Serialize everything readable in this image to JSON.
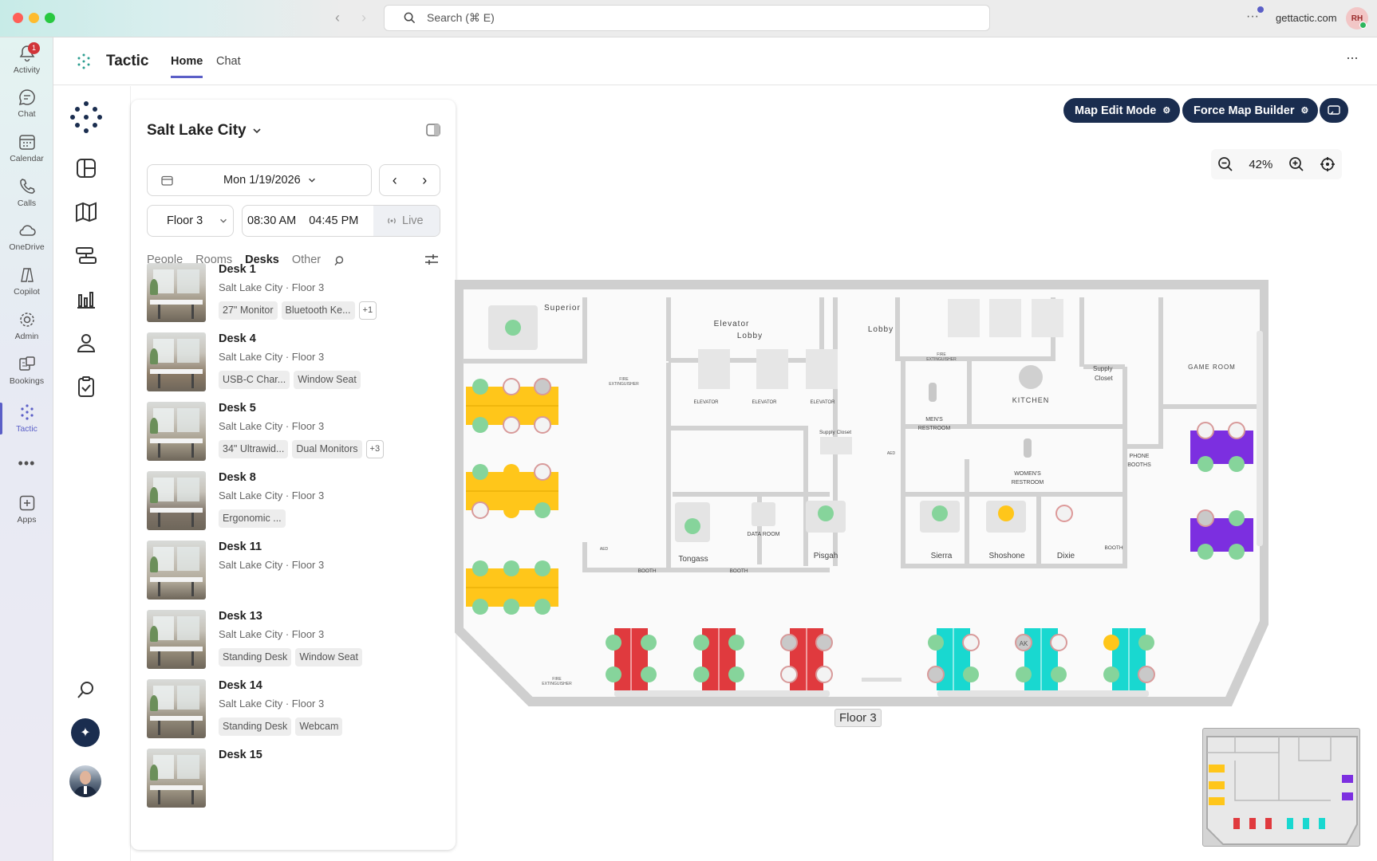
{
  "titlebar": {
    "search_placeholder": "Search (⌘ E)",
    "account_domain": "gettactic.com",
    "account_initials": "RH"
  },
  "rail": {
    "items": [
      {
        "label": "Activity",
        "icon": "bell-icon",
        "badge": "1"
      },
      {
        "label": "Chat",
        "icon": "chat-icon"
      },
      {
        "label": "Calendar",
        "icon": "calendar-icon"
      },
      {
        "label": "Calls",
        "icon": "phone-icon"
      },
      {
        "label": "OneDrive",
        "icon": "cloud-icon"
      },
      {
        "label": "Copilot",
        "icon": "copilot-icon"
      },
      {
        "label": "Admin",
        "icon": "admin-gear-icon"
      },
      {
        "label": "Bookings",
        "icon": "bookings-icon"
      },
      {
        "label": "Tactic",
        "icon": "tactic-icon",
        "active": true
      },
      {
        "label": "",
        "icon": "more-dots-icon"
      },
      {
        "label": "Apps",
        "icon": "add-app-icon"
      }
    ]
  },
  "header": {
    "app_name": "Tactic",
    "tabs": [
      {
        "label": "Home",
        "active": true
      },
      {
        "label": "Chat"
      }
    ]
  },
  "panel": {
    "location": "Salt Lake City",
    "date": "Mon 1/19/2026",
    "floor": "Floor 3",
    "start_time": "08:30 AM",
    "end_time": "04:45 PM",
    "live_label": "Live",
    "tabs": [
      {
        "label": "People"
      },
      {
        "label": "Rooms"
      },
      {
        "label": "Desks",
        "active": true
      },
      {
        "label": "Other"
      }
    ],
    "desks": [
      {
        "name": "Desk 1",
        "location": "Salt Lake City · Floor 3",
        "tags": [
          "27\" Monitor",
          "Bluetooth Ke..."
        ],
        "more": "+1"
      },
      {
        "name": "Desk 4",
        "location": "Salt Lake City · Floor 3",
        "tags": [
          "USB-C Char...",
          "Window Seat"
        ],
        "more": ""
      },
      {
        "name": "Desk 5",
        "location": "Salt Lake City · Floor 3",
        "tags": [
          "34\" Ultrawid...",
          "Dual Monitors"
        ],
        "more": "+3"
      },
      {
        "name": "Desk 8",
        "location": "Salt Lake City · Floor 3",
        "tags": [
          "Ergonomic ..."
        ],
        "more": ""
      },
      {
        "name": "Desk 11",
        "location": "Salt Lake City · Floor 3",
        "tags": [],
        "more": ""
      },
      {
        "name": "Desk 13",
        "location": "Salt Lake City · Floor 3",
        "tags": [
          "Standing Desk",
          "Window Seat"
        ],
        "more": ""
      },
      {
        "name": "Desk 14",
        "location": "Salt Lake City · Floor 3",
        "tags": [
          "Standing Desk",
          "Webcam"
        ],
        "more": ""
      },
      {
        "name": "Desk 15",
        "location": "",
        "tags": [],
        "more": ""
      }
    ]
  },
  "map": {
    "map_edit_label": "Map Edit Mode",
    "force_builder_label": "Force Map Builder",
    "zoom": "42%",
    "floor_label": "Floor 3",
    "rooms": {
      "superior": "Superior",
      "elevator_lobby_1": "Elevator",
      "elevator_lobby_2": "Lobby",
      "lobby": "Lobby",
      "game_room": "GAME ROOM",
      "supply_closet_1": "Supply",
      "supply_closet_2": "Closet",
      "kitchen": "KITCHEN",
      "mens_1": "MEN'S",
      "mens_2": "RESTROOM",
      "womens_1": "WOMEN'S",
      "womens_2": "RESTROOM",
      "phone_1": "PHONE",
      "phone_2": "BOOTHS",
      "supply_small": "Supply Closet",
      "data_room": "DATA ROOM",
      "tongass": "Tongass",
      "pisgah": "Pisgah",
      "sierra": "Sierra",
      "shoshone": "Shoshone",
      "dixie": "Dixie",
      "booth": "BOOTH",
      "elevator": "ELEVATOR",
      "fire_1": "FIRE",
      "fire_2": "EXTINGUISHER",
      "aed": "AED",
      "avatar_ak": "AK"
    },
    "colors": {
      "available": "#86d49b",
      "yellow_bank": "#ffc61a",
      "red_bank": "#e03a3e",
      "cyan_bank": "#19d8d0",
      "purple_bank": "#7c2fe0",
      "reserved": "#f2c4c4",
      "accent_nav": "#1a2d4f"
    }
  }
}
